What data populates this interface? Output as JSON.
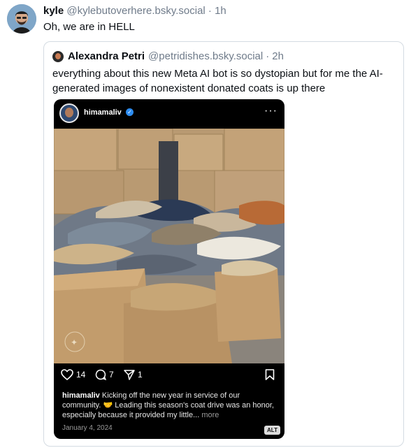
{
  "post": {
    "author": "kyle",
    "handle": "@kylebutoverhere.bsky.social",
    "separator": "·",
    "time": "1h",
    "text": "Oh, we are in HELL"
  },
  "quote": {
    "author": "Alexandra Petri",
    "handle": "@petridishes.bsky.social",
    "separator": "·",
    "time": "2h",
    "text": "everything about this new Meta AI bot is so dystopian but for me the AI-generated images of nonexistent donated coats is up there"
  },
  "instagram": {
    "username": "himamaliv",
    "more": "···",
    "likes": "14",
    "comments": "7",
    "shares": "1",
    "caption_user": "himamaliv",
    "caption_text": "Kicking off the new year in service of our community. 🤝 Leading this season's coat drive was an honor, especially because it provided my little...",
    "caption_more": "more",
    "date": "January 4, 2024",
    "alt_badge": "ALT"
  },
  "colors": {
    "text": "#0b0f14",
    "muted": "#6f7b8a",
    "border": "#d4dbe2",
    "instagram_bg": "#000000",
    "verified": "#2d8cf0"
  }
}
